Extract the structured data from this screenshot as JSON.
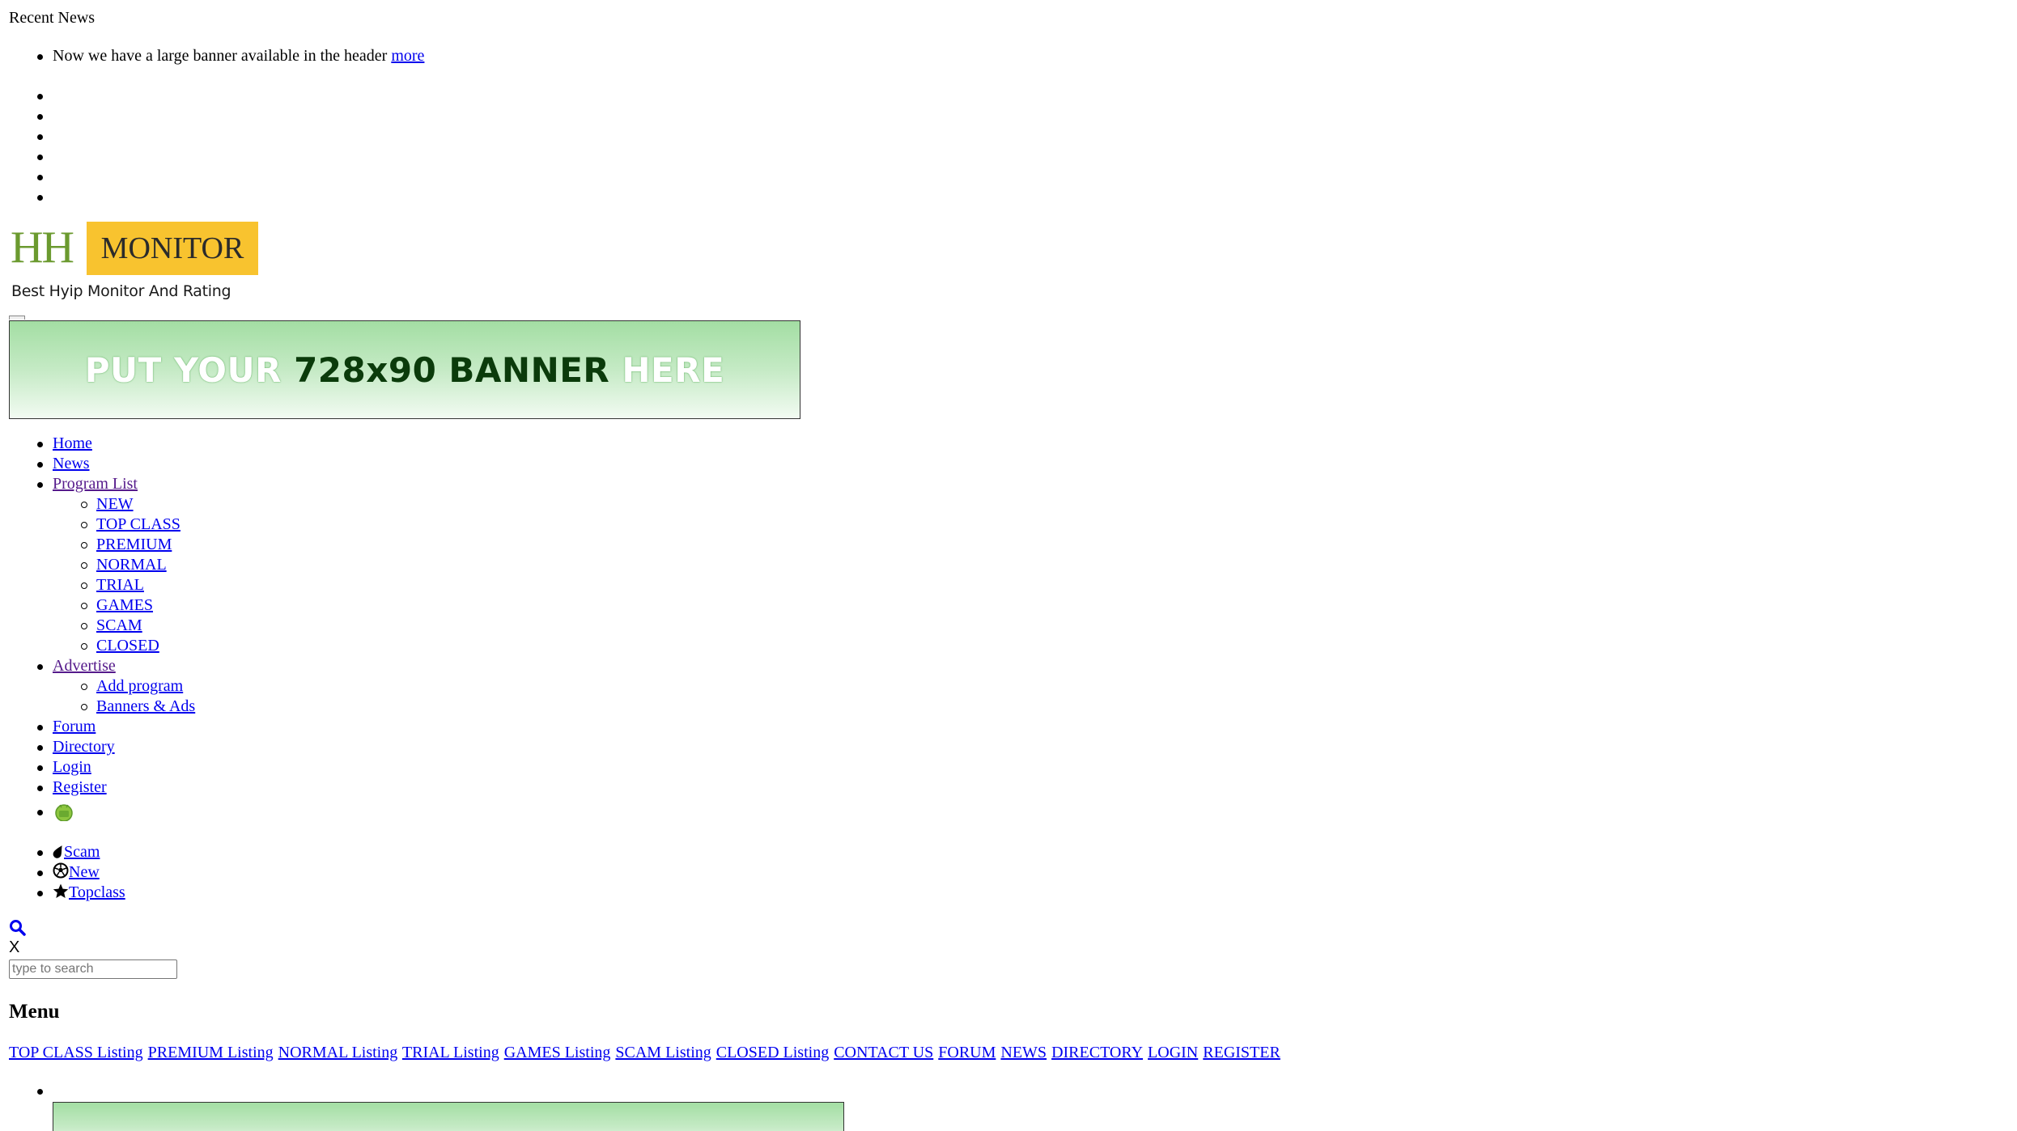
{
  "recent_news": {
    "title": "Recent News",
    "item_text": "Now we have a large banner available in the header",
    "more_link": "more"
  },
  "logo": {
    "hh": "HH",
    "monitor": "MONITOR",
    "tagline": "Best Hyip Monitor And Rating",
    "colors": {
      "hh": "#6b9a2f",
      "monitor_bg": "#f8c32f"
    }
  },
  "banner": {
    "part1": "PUT YOUR ",
    "part2": "728x90 BANNER",
    "part3": " HERE"
  },
  "main_nav": {
    "home": "Home",
    "news": "News",
    "program_list": "Program List",
    "program_sub": {
      "new": "NEW",
      "top_class": "TOP CLASS",
      "premium": "PREMIUM",
      "normal": "NORMAL",
      "trial": "TRIAL",
      "games": "GAMES",
      "scam": "SCAM",
      "closed": "CLOSED"
    },
    "advertise": "Advertise",
    "advertise_sub": {
      "add_program": "Add program",
      "banners_ads": "Banners & Ads"
    },
    "forum": "Forum",
    "directory": "Directory",
    "login": "Login",
    "register": "Register",
    "android_icon": "android-icon"
  },
  "quick_links": {
    "scam": "Scam",
    "new": "New",
    "topclass": "Topclass",
    "icons": [
      "tint-icon",
      "soccer-ball-icon",
      "star-icon"
    ]
  },
  "search": {
    "icon": "search-icon",
    "close": "X",
    "placeholder": "type to search"
  },
  "menu": {
    "heading": "Menu",
    "links": {
      "top_class": "TOP CLASS Listing",
      "premium": "PREMIUM Listing",
      "normal": "NORMAL Listing",
      "trial": "TRIAL Listing",
      "games": "GAMES Listing",
      "scam": "SCAM Listing",
      "closed": "CLOSED Listing",
      "contact": "CONTACT US",
      "forum": "FORUM",
      "news": "NEWS",
      "directory": "DIRECTORY",
      "login": "LOGIN",
      "register": "REGISTER"
    }
  },
  "colors": {
    "link": "#0000ee",
    "visited_link": "#551a8b",
    "banner_green": "#a3dea3"
  }
}
